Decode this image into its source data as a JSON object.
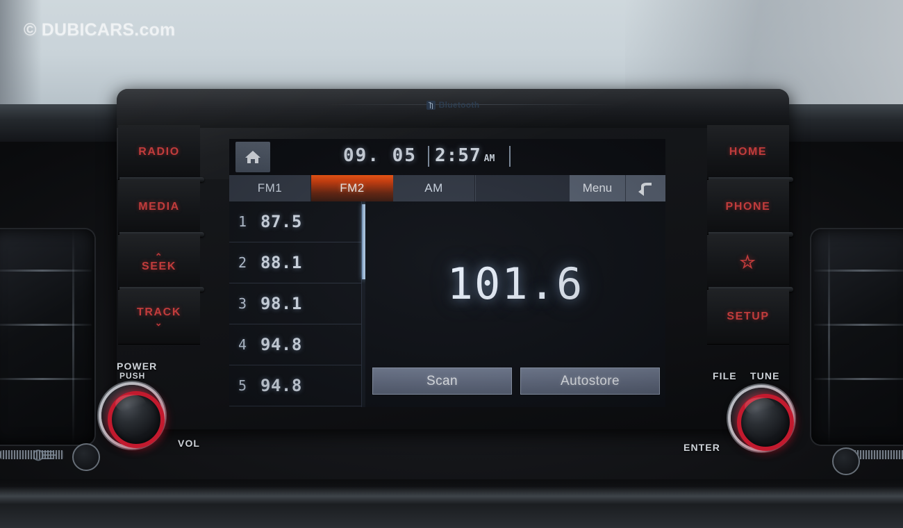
{
  "watermark": "© DUBICARS.com",
  "bezel": {
    "bluetooth_label": "Bluetooth"
  },
  "left_buttons": [
    {
      "label": "RADIO",
      "name": "radio-button"
    },
    {
      "label": "MEDIA",
      "name": "media-button"
    },
    {
      "label": "SEEK",
      "name": "seek-button",
      "chevron": "⌃"
    },
    {
      "label": "TRACK",
      "name": "track-button",
      "chevron": "⌄"
    }
  ],
  "right_buttons": [
    {
      "label": "HOME",
      "name": "home-button"
    },
    {
      "label": "PHONE",
      "name": "phone-button"
    },
    {
      "label": "☆",
      "name": "favorite-star-button"
    },
    {
      "label": "SETUP",
      "name": "setup-button"
    }
  ],
  "knobs": {
    "left": {
      "title": "POWER",
      "subtitle": "PUSH",
      "side_label": "VOL"
    },
    "right": {
      "label_a": "FILE",
      "label_b": "TUNE",
      "side_label": "ENTER"
    }
  },
  "screen": {
    "status": {
      "home_icon": "home-icon",
      "date": "09. 05",
      "time": "2:57",
      "meridiem": "AM"
    },
    "tabs": [
      {
        "label": "FM1",
        "active": false
      },
      {
        "label": "FM2",
        "active": true
      },
      {
        "label": "AM",
        "active": false
      }
    ],
    "menu_label": "Menu",
    "back_icon": "back-arrow-icon",
    "presets": [
      {
        "number": "1",
        "frequency": "87.5"
      },
      {
        "number": "2",
        "frequency": "88.1"
      },
      {
        "number": "3",
        "frequency": "98.1"
      },
      {
        "number": "4",
        "frequency": "94.8"
      },
      {
        "number": "5",
        "frequency": "94.8"
      }
    ],
    "current_frequency": "101.6",
    "actions": [
      {
        "label": "Scan",
        "name": "scan-button"
      },
      {
        "label": "Autostore",
        "name": "autostore-button"
      }
    ]
  },
  "colors": {
    "accent_red": "#c03c3c",
    "active_tab_orange": "#ff5a12",
    "screen_text": "#e8f0fb",
    "knob_ring": "#c31a2e"
  }
}
